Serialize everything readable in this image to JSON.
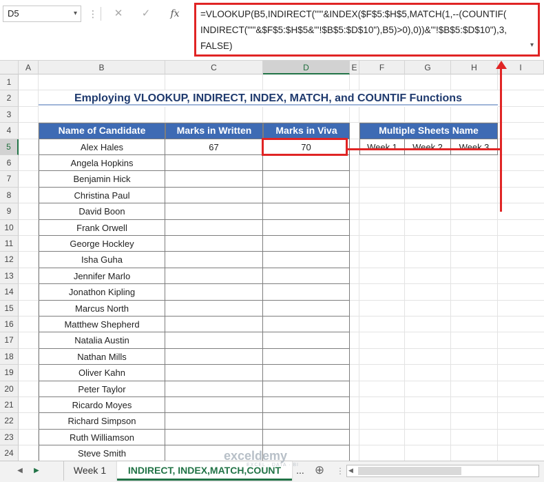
{
  "formula_bar": {
    "name_box": "D5",
    "cancel_icon": "✕",
    "enter_icon": "✓",
    "fx_label": "fx",
    "formula": "=VLOOKUP(B5,INDIRECT(\"'\"&INDEX($F$5:$H$5,MATCH(1,--(COUNTIF(\nINDIRECT(\"'\"&$F$5:$H$5&\"'!$B$5:$D$10\"),B5)>0),0))&\"'!$B$5:$D$10\"),3,\nFALSE)"
  },
  "columns": [
    "A",
    "B",
    "C",
    "D",
    "E",
    "F",
    "G",
    "H",
    "I"
  ],
  "rows": [
    "1",
    "2",
    "3",
    "4",
    "5",
    "6",
    "7",
    "8",
    "9",
    "10",
    "11",
    "12",
    "13",
    "14",
    "15",
    "16",
    "17",
    "18",
    "19",
    "20",
    "21",
    "22",
    "23",
    "24"
  ],
  "sheet": {
    "title": "Employing VLOOKUP, INDIRECT, INDEX, MATCH, and COUNTIF Functions",
    "headers": [
      "Name of Candidate",
      "Marks in Written",
      "Marks in Viva"
    ],
    "candidates": [
      {
        "name": "Alex Hales",
        "written": "67",
        "viva": "70"
      },
      {
        "name": "Angela Hopkins",
        "written": "",
        "viva": ""
      },
      {
        "name": "Benjamin Hick",
        "written": "",
        "viva": ""
      },
      {
        "name": "Christina Paul",
        "written": "",
        "viva": ""
      },
      {
        "name": "David Boon",
        "written": "",
        "viva": ""
      },
      {
        "name": "Frank Orwell",
        "written": "",
        "viva": ""
      },
      {
        "name": "George Hockley",
        "written": "",
        "viva": ""
      },
      {
        "name": "Isha Guha",
        "written": "",
        "viva": ""
      },
      {
        "name": "Jennifer Marlo",
        "written": "",
        "viva": ""
      },
      {
        "name": "Jonathon Kipling",
        "written": "",
        "viva": ""
      },
      {
        "name": "Marcus North",
        "written": "",
        "viva": ""
      },
      {
        "name": "Matthew Shepherd",
        "written": "",
        "viva": ""
      },
      {
        "name": "Natalia Austin",
        "written": "",
        "viva": ""
      },
      {
        "name": "Nathan Mills",
        "written": "",
        "viva": ""
      },
      {
        "name": "Oliver Kahn",
        "written": "",
        "viva": ""
      },
      {
        "name": "Peter Taylor",
        "written": "",
        "viva": ""
      },
      {
        "name": "Ricardo Moyes",
        "written": "",
        "viva": ""
      },
      {
        "name": "Richard Simpson",
        "written": "",
        "viva": ""
      },
      {
        "name": "Ruth Williamson",
        "written": "",
        "viva": ""
      },
      {
        "name": "Steve Smith",
        "written": "",
        "viva": ""
      }
    ],
    "sheets_header": "Multiple Sheets Name",
    "sheet_names": [
      "Week 1",
      "Week 2",
      "Week 3"
    ]
  },
  "tabs": {
    "prev_icon": "◀",
    "next_icon": "▶",
    "items": [
      "Week 1",
      "INDIRECT, INDEX,MATCH,COUNT"
    ],
    "more": "...",
    "add_icon": "⊕"
  },
  "watermark": "exceldemy",
  "watermark_sub": "EXCEL · DATA · BI",
  "colors": {
    "header_fill": "#3e6bb4",
    "highlight": "#e02424",
    "excel_green": "#217346"
  }
}
